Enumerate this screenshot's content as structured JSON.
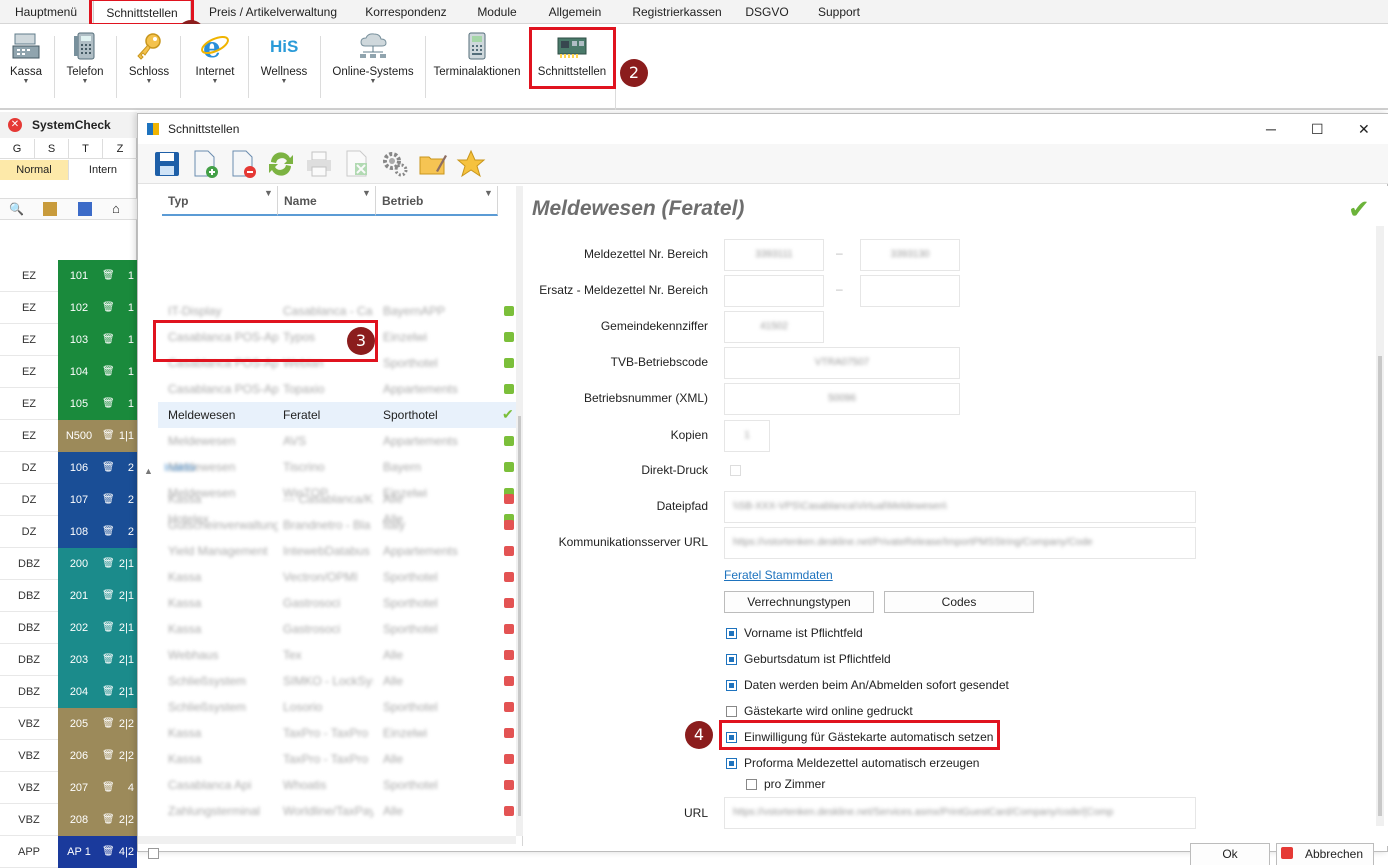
{
  "menu": {
    "items": [
      "Hauptmenü",
      "Schnittstellen",
      "Preis / Artikelverwaltung",
      "Korrespondenz",
      "Module",
      "Allgemein",
      "Registrierkassen",
      "DSGVO",
      "Support"
    ]
  },
  "ribbon": {
    "buttons": [
      {
        "label": "Kassa",
        "icon": "cash-register-icon"
      },
      {
        "label": "Telefon",
        "icon": "telephone-icon"
      },
      {
        "label": "Schloss",
        "icon": "key-icon"
      },
      {
        "label": "Internet",
        "icon": "internet-explorer-icon"
      },
      {
        "label": "Wellness",
        "icon": "his-logo-icon"
      },
      {
        "label": "Online-Systems",
        "icon": "cloud-network-icon"
      },
      {
        "label": "Terminalaktionen",
        "icon": "card-terminal-icon"
      },
      {
        "label": "Schnittstellen",
        "icon": "interface-board-icon"
      }
    ]
  },
  "badges": [
    "1",
    "2",
    "3",
    "4"
  ],
  "syscheck": {
    "title": "SystemCheck",
    "cols": [
      "G",
      "S",
      "T",
      "Z"
    ],
    "mode": "Normal",
    "mode2": "Intern",
    "rooms": [
      {
        "type": "EZ",
        "no": "101",
        "cnt": "1",
        "color": "#1a8a3c"
      },
      {
        "type": "EZ",
        "no": "102",
        "cnt": "1",
        "color": "#1a8a3c"
      },
      {
        "type": "EZ",
        "no": "103",
        "cnt": "1",
        "color": "#1a8a3c"
      },
      {
        "type": "EZ",
        "no": "104",
        "cnt": "1",
        "color": "#1a8a3c"
      },
      {
        "type": "EZ",
        "no": "105",
        "cnt": "1",
        "color": "#1a8a3c"
      },
      {
        "type": "EZ",
        "no": "N500",
        "cnt": "1|1",
        "color": "#9c8a5a"
      },
      {
        "type": "DZ",
        "no": "106",
        "cnt": "2",
        "color": "#1a4e96"
      },
      {
        "type": "DZ",
        "no": "107",
        "cnt": "2",
        "color": "#1a4e96"
      },
      {
        "type": "DZ",
        "no": "108",
        "cnt": "2",
        "color": "#1a4e96"
      },
      {
        "type": "DBZ",
        "no": "200",
        "cnt": "2|1",
        "color": "#1b8b8b"
      },
      {
        "type": "DBZ",
        "no": "201",
        "cnt": "2|1",
        "color": "#1b8b8b"
      },
      {
        "type": "DBZ",
        "no": "202",
        "cnt": "2|1",
        "color": "#1b8b8b"
      },
      {
        "type": "DBZ",
        "no": "203",
        "cnt": "2|1",
        "color": "#1b8b8b"
      },
      {
        "type": "DBZ",
        "no": "204",
        "cnt": "2|1",
        "color": "#1b8b8b"
      },
      {
        "type": "VBZ",
        "no": "205",
        "cnt": "2|2",
        "color": "#9c8a5a"
      },
      {
        "type": "VBZ",
        "no": "206",
        "cnt": "2|2",
        "color": "#9c8a5a"
      },
      {
        "type": "VBZ",
        "no": "207",
        "cnt": "4",
        "color": "#9c8a5a"
      },
      {
        "type": "VBZ",
        "no": "208",
        "cnt": "2|2",
        "color": "#9c8a5a"
      },
      {
        "type": "APP",
        "no": "AP 1",
        "cnt": "4|2",
        "color": "#1a3a9c"
      }
    ]
  },
  "dialog": {
    "title": "Schnittstellen",
    "grid": {
      "headers": [
        "Typ",
        "Name",
        "Betrieb"
      ],
      "selected": {
        "typ": "Meldewesen",
        "name": "Feratel",
        "betrieb": "Sporthotel"
      },
      "rows_top": [
        [
          "IT-Display",
          "Casablanca - Cas",
          "BayernAPP"
        ],
        [
          "Casablanca POS-Api",
          "Typos",
          "Einzelwi"
        ],
        [
          "Casablanca POS-Api",
          "Webian",
          "Sporthotel"
        ],
        [
          "Casablanca POS-Api",
          "Topaxio",
          "Appartements"
        ]
      ],
      "rows_mid": [
        [
          "Meldewesen",
          "AVS",
          "Appartements"
        ],
        [
          "Meldewesen",
          "Tiscrino",
          "Bayern"
        ],
        [
          "Meldewesen",
          "WinTOP",
          "Einzelwi"
        ],
        [
          "Hotelex",
          "",
          "Alle"
        ]
      ],
      "group2": "Inaktiv",
      "rows_bottom": [
        [
          "Kassa",
          "--- Casablanca/Ka",
          "Alle"
        ],
        [
          "Gutscheinverwaltung",
          "Brandnetro - Bla",
          "Italy"
        ],
        [
          "Yield Management",
          "IntewebDatabus",
          "Appartements"
        ],
        [
          "Kassa",
          "Vectron/OPMI",
          "Sporthotel"
        ],
        [
          "Kassa",
          "Gastrosoci",
          "Sporthotel"
        ],
        [
          "Kassa",
          "Gastrosoci",
          "Sporthotel"
        ],
        [
          "Webhaus",
          "Tex",
          "Alle"
        ],
        [
          "Schließsystem",
          "SIMKO - LockSyst",
          "Alle"
        ],
        [
          "Schließsystem",
          "Losorio",
          "Sporthotel"
        ],
        [
          "Kassa",
          "TaxPro - TaxPro",
          "Einzelwi"
        ],
        [
          "Kassa",
          "TaxPro - TaxPro",
          "Alle"
        ],
        [
          "Casablanca Api",
          "Whoatis",
          "Sporthotel"
        ],
        [
          "Zahlungsterminal",
          "Worldline/TaxPay",
          "Alle"
        ]
      ]
    },
    "form": {
      "title": "Meldewesen (Feratel)",
      "labels": {
        "mz_range": "Meldezettel Nr. Bereich",
        "ersatz_range": "Ersatz - Meldezettel Nr. Bereich",
        "gkz": "Gemeindekennziffer",
        "tvb": "TVB-Betriebscode",
        "betrnr": "Betriebsnummer (XML)",
        "kopien": "Kopien",
        "direkt": "Direkt-Druck",
        "pfad": "Dateipfad",
        "kurl": "Kommunikationsserver URL",
        "url": "URL"
      },
      "values": {
        "mz_from": "3393111",
        "mz_to": "3393130",
        "gkz": "41502",
        "tvb": "VTRA07507",
        "betrnr": "50096",
        "kopien": "1",
        "pfad": "\\\\SB-XXX-VPS\\Casablanca\\Virtual\\Meldewesen\\",
        "kurl": "https://vstortenken.deskline.net/PrivateRelease/ImportPMSString/Company/Code",
        "url": "https://vstortenken.deskline.net/Services.asmx/PrintGuestCard/Company/code/{Comp"
      },
      "link": "Feratel Stammdaten",
      "buttons": {
        "verrechnung": "Verrechnungstypen",
        "codes": "Codes"
      },
      "checkboxes": [
        {
          "label": "Vorname ist Pflichtfeld",
          "checked": true
        },
        {
          "label": "Geburtsdatum ist Pflichtfeld",
          "checked": true
        },
        {
          "label": "Daten werden beim An/Abmelden sofort gesendet",
          "checked": true
        },
        {
          "label": "Gästekarte wird online gedruckt",
          "checked": false
        },
        {
          "label": "Einwilligung für Gästekarte automatisch setzen",
          "checked": true
        },
        {
          "label": "Proforma Meldezettel automatisch erzeugen",
          "checked": true
        },
        {
          "label": "pro Zimmer",
          "checked": false
        }
      ]
    },
    "footer": {
      "ok": "Ok",
      "cancel": "Abbrechen"
    }
  }
}
